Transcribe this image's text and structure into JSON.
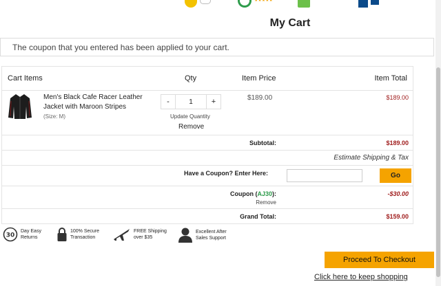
{
  "page": {
    "title": "My Cart"
  },
  "notice": {
    "text": "The coupon that you entered has been applied to your cart."
  },
  "cart": {
    "headers": {
      "items": "Cart Items",
      "qty": "Qty",
      "price": "Item Price",
      "total": "Item Total"
    },
    "item": {
      "name": "Men's Black Cafe Racer Leather Jacket with Maroon Stripes",
      "size": "(Size: M)",
      "qty": "1",
      "minus": "-",
      "plus": "+",
      "update_label": "Update Quantity",
      "remove_label": "Remove",
      "price": "$189.00",
      "total": "$189.00"
    },
    "subtotal": {
      "label": "Subtotal:",
      "value": "$189.00"
    },
    "shipping": {
      "link": "Estimate Shipping & Tax"
    },
    "coupon_entry": {
      "label": "Have a Coupon? Enter Here:",
      "input_value": "",
      "button": "Go"
    },
    "coupon": {
      "prefix": "Coupon (",
      "code": "AJ30",
      "suffix": "):",
      "remove": "Remove",
      "value": "-$30.00"
    },
    "grand_total": {
      "label": "Grand Total:",
      "value": "$159.00"
    }
  },
  "features": [
    {
      "icon": "30-day-returns-icon",
      "line1": "Day Easy",
      "line2": "Returns"
    },
    {
      "icon": "padlock-icon",
      "line1": "100% Secure",
      "line2": "Transaction"
    },
    {
      "icon": "airplane-icon",
      "line1": "FREE Shipping",
      "line2": "over $35"
    },
    {
      "icon": "support-agent-icon",
      "line1": "Excellent After",
      "line2": "Sales Support"
    }
  ],
  "actions": {
    "checkout": "Proceed To Checkout",
    "keep_shopping": "Click here to keep shopping"
  },
  "colors": {
    "accent": "#f5a300",
    "price": "#a01e1e",
    "coupon_code": "#2e9c4c"
  }
}
